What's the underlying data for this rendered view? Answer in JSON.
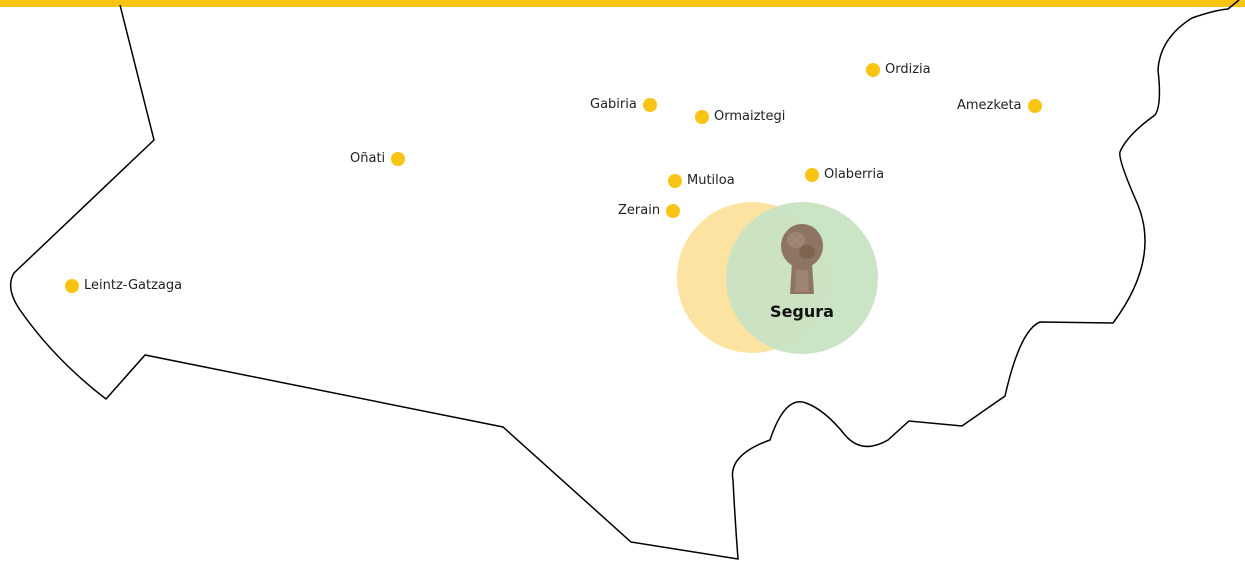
{
  "colors": {
    "accent_bar": "#F9C413",
    "town_dot": "#F9C413",
    "outline": "#000000",
    "highlight_yellow": "#FCE3A1",
    "highlight_green": "#C9E3C3",
    "stele_stone": "#8E7462"
  },
  "icons": {
    "town_marker": "yellow-dot-icon",
    "featured_town_marker": "funerary-stele-icon"
  },
  "featured_town": {
    "name": "Segura"
  },
  "towns": [
    {
      "name": "Ordizia"
    },
    {
      "name": "Gabiria"
    },
    {
      "name": "Ormaiztegi"
    },
    {
      "name": "Amezketa"
    },
    {
      "name": "Oñati"
    },
    {
      "name": "Mutiloa"
    },
    {
      "name": "Olaberria"
    },
    {
      "name": "Zerain"
    },
    {
      "name": "Leintz-Gatzaga"
    }
  ]
}
